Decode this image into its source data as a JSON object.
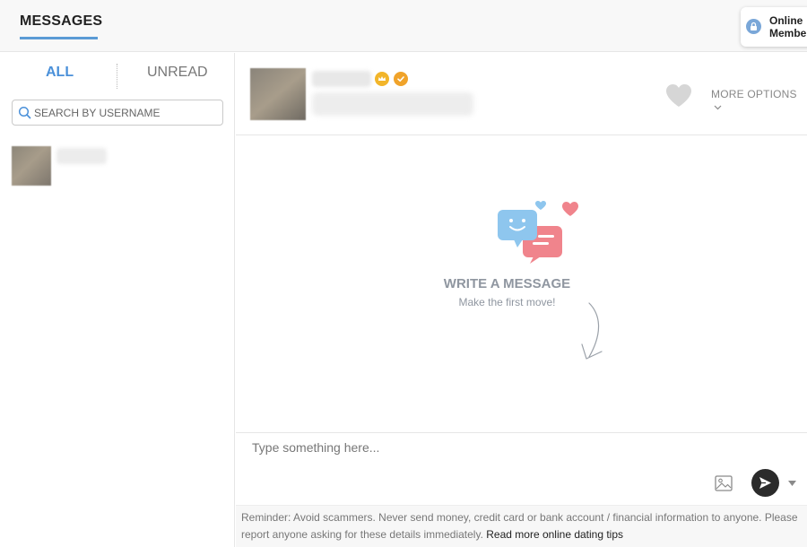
{
  "header": {
    "title": "MESSAGES",
    "online_members": {
      "line1": "Online",
      "line2": "Member"
    }
  },
  "sidebar": {
    "tabs": [
      {
        "label": "ALL",
        "active": true
      },
      {
        "label": "UNREAD",
        "active": false
      }
    ],
    "search": {
      "placeholder": "SEARCH BY USERNAME",
      "value": ""
    }
  },
  "chat": {
    "more_options_label": "MORE OPTIONS",
    "empty_state": {
      "title": "WRITE A MESSAGE",
      "subtitle": "Make the first move!"
    },
    "composer": {
      "placeholder": "Type something here...",
      "value": ""
    }
  },
  "footer": {
    "reminder": "Reminder: Avoid scammers. Never send money, credit card or bank account / financial information to anyone. Please report anyone asking for these details immediately.",
    "link_label": "Read more online dating tips"
  },
  "colors": {
    "accent": "#4a90d9",
    "tab_inactive": "#777777",
    "send_button": "#2b2b2b",
    "badge_gold": "#f2b52a",
    "bubble_blue": "#8ec6ee",
    "bubble_pink": "#f0848c"
  },
  "icons": {
    "online": "lock-icon",
    "search": "search-icon",
    "badge1": "crown-badge-icon",
    "badge2": "verified-check-icon",
    "favorite": "heart-icon",
    "more": "chevron-down-icon",
    "image": "image-icon",
    "send": "send-icon",
    "send_options": "caret-down-icon"
  }
}
